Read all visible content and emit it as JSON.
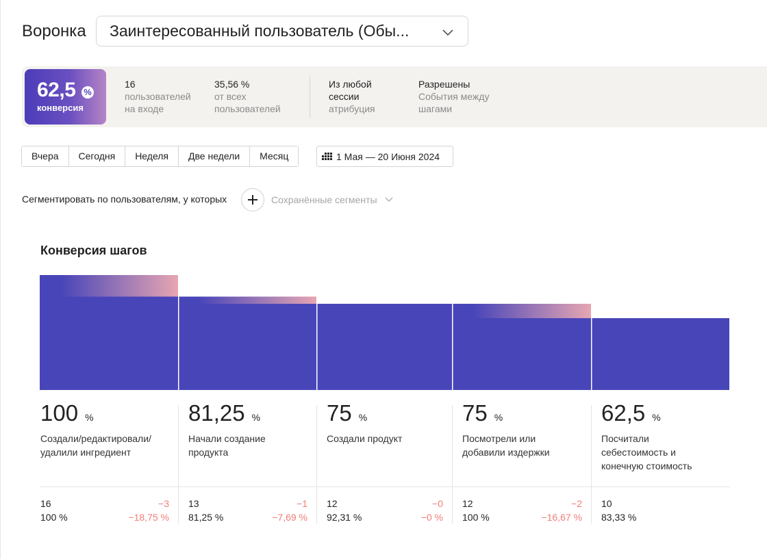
{
  "header": {
    "label": "Воронка",
    "funnel_value": "Заинтересованный пользователь (Обы..."
  },
  "summary": {
    "conversion_value": "62,5",
    "conversion_percent_sign": "%",
    "conversion_label": "конверсия",
    "users_count": "16",
    "users_sub1": "пользователей",
    "users_sub2": "на входе",
    "share_value": "35,56 %",
    "share_sub1": "от всех",
    "share_sub2": "пользователей",
    "attribution_top1": "Из любой",
    "attribution_top2": "сессии",
    "attribution_sub": "атрибуция",
    "events_top": "Разрешены",
    "events_sub1": "События между",
    "events_sub2": "шагами"
  },
  "periods": [
    "Вчера",
    "Сегодня",
    "Неделя",
    "Две недели",
    "Месяц"
  ],
  "date_range": "1 Мая — 20 Июня 2024",
  "segment": {
    "label": "Сегментировать по пользователям, у которых",
    "saved": "Сохранённые сегменты"
  },
  "chart_title": "Конверсия шагов",
  "colors": {
    "bar": "#4845b9",
    "drop_gradient_end": "#e7a6b2",
    "negative": "#f07d78"
  },
  "chart_data": {
    "type": "bar",
    "categories": [
      "Создали/редактировали/ удалили ингредиент",
      "Начали создание продукта",
      "Создали продукт",
      "Посмотрели или добавили издержки",
      "Посчитали себестоимость и конечную стоимость"
    ],
    "values": [
      100,
      81.25,
      75,
      75,
      62.5
    ],
    "ylim": [
      0,
      100
    ]
  },
  "steps": [
    {
      "percent": "100",
      "unit": "%",
      "name_lines": [
        "Создали/редактировали/",
        "удалили ингредиент"
      ],
      "count": "16",
      "count_pct": "100 %",
      "drop": "−3",
      "drop_pct": "−18,75 %"
    },
    {
      "percent": "81,25",
      "unit": "%",
      "name_lines": [
        "Начали создание",
        "продукта"
      ],
      "count": "13",
      "count_pct": "81,25 %",
      "drop": "−1",
      "drop_pct": "−7,69 %"
    },
    {
      "percent": "75",
      "unit": "%",
      "name_lines": [
        "Создали продукт"
      ],
      "count": "12",
      "count_pct": "92,31 %",
      "drop": "−0",
      "drop_pct": "−0 %"
    },
    {
      "percent": "75",
      "unit": "%",
      "name_lines": [
        "Посмотрели или",
        "добавили издержки"
      ],
      "count": "12",
      "count_pct": "100 %",
      "drop": "−2",
      "drop_pct": "−16,67 %"
    },
    {
      "percent": "62,5",
      "unit": "%",
      "name_lines": [
        "Посчитали",
        "себестоимость и",
        "конечную стоимость"
      ],
      "count": "10",
      "count_pct": "83,33 %",
      "drop": "",
      "drop_pct": ""
    }
  ]
}
